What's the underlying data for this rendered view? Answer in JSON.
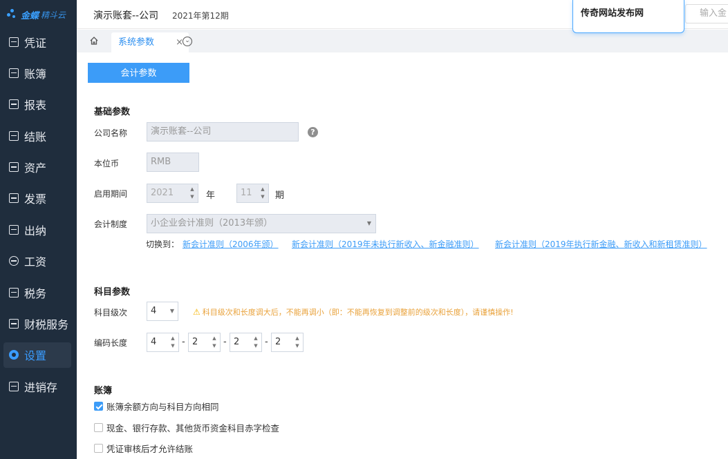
{
  "brand": {
    "name": "金蝶",
    "product": "精斗云"
  },
  "sidebar": {
    "items": [
      {
        "label": "凭证",
        "icon": "voucher-icon"
      },
      {
        "label": "账簿",
        "icon": "ledger-icon"
      },
      {
        "label": "报表",
        "icon": "report-icon"
      },
      {
        "label": "结账",
        "icon": "closing-icon"
      },
      {
        "label": "资产",
        "icon": "asset-icon"
      },
      {
        "label": "发票",
        "icon": "invoice-icon"
      },
      {
        "label": "出纳",
        "icon": "cashier-icon"
      },
      {
        "label": "工资",
        "icon": "salary-icon"
      },
      {
        "label": "税务",
        "icon": "tax-icon"
      },
      {
        "label": "财税服务",
        "icon": "service-icon"
      },
      {
        "label": "设置",
        "icon": "settings-icon",
        "active": true
      },
      {
        "label": "进销存",
        "icon": "inventory-icon"
      }
    ]
  },
  "header": {
    "account": "演示账套--公司",
    "period": "2021年第12期",
    "search_placeholder": "输入金",
    "popup_text": "传奇网站发布网"
  },
  "tabs": {
    "active_label": "系统参数",
    "close_glyph": "×"
  },
  "main": {
    "primary_button": "会计参数",
    "basic": {
      "title": "基础参数",
      "company_label": "公司名称",
      "company_value": "演示账套--公司",
      "currency_label": "本位币",
      "currency_value": "RMB",
      "period_label": "启用期间",
      "year_value": "2021",
      "year_unit": "年",
      "month_value": "11",
      "month_unit": "期",
      "system_label": "会计制度",
      "system_value": "小企业会计准则（2013年颁）",
      "switch_label": "切换到：",
      "switch_links": [
        "新会计准则（2006年颁）",
        "新会计准则（2019年未执行新收入、新金融准则）",
        "新会计准则（2019年执行新金融、新收入和新租赁准则）"
      ]
    },
    "subject": {
      "title": "科目参数",
      "level_label": "科目级次",
      "level_value": "4",
      "warning": "科目级次和长度调大后，不能再调小（即：不能再恢复到调整前的级次和长度），请谨慎操作!",
      "code_label": "编码长度",
      "code_values": [
        "4",
        "2",
        "2",
        "2"
      ],
      "dash": "-"
    },
    "ledger": {
      "title": "账簿",
      "options": [
        {
          "label": "账簿余额方向与科目方向相同",
          "checked": true
        },
        {
          "label": "现金、银行存款、其他货币资金科目赤字检查",
          "checked": false
        },
        {
          "label": "凭证审核后才允许结账",
          "checked": false
        }
      ]
    }
  },
  "colors": {
    "sidebar_bg": "#1f2d3d",
    "accent": "#3c9cf8",
    "warning": "#e9a23b"
  }
}
